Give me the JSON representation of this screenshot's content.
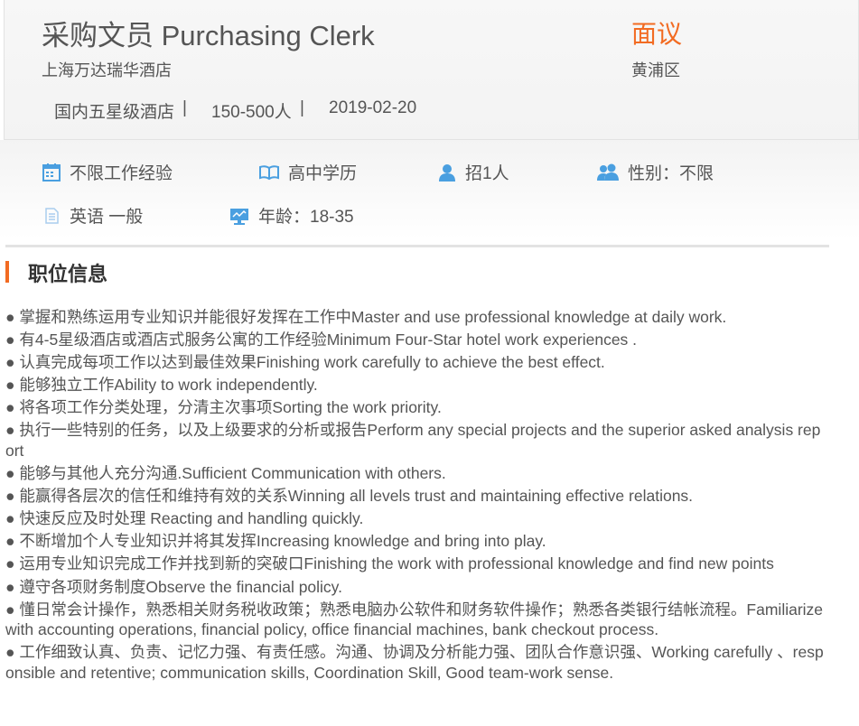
{
  "header": {
    "title": "采购文员 Purchasing Clerk",
    "salary": "面议",
    "company": "上海万达瑞华酒店",
    "district": "黄浦区",
    "meta": {
      "industry": "国内五星级酒店",
      "size": "150-500人",
      "date": "2019-02-20",
      "separator": "|"
    }
  },
  "requirements": {
    "experience": "不限工作经验",
    "education": "高中学历",
    "headcount": "招1人",
    "gender": "性别：不限",
    "language": "英语 一般",
    "age": "年龄：18-35",
    "icons": {
      "experience": "calendar-icon",
      "education": "book-icon",
      "headcount": "person-icon",
      "gender": "people-icon",
      "language": "document-icon",
      "age": "monitor-icon"
    },
    "icon_color": "#4a9fe0"
  },
  "section": {
    "title": "职位信息",
    "accent": "#f26b22"
  },
  "duties": [
    "● 掌握和熟练运用专业知识并能很好发挥在工作中Master and use professional knowledge at daily work.",
    "● 有4-5星级酒店或酒店式服务公寓的工作经验Minimum Four-Star hotel work experiences .",
    "● 认真完成每项工作以达到最佳效果Finishing work carefully  to achieve the best effect.",
    "● 能够独立工作Ability to work independently.",
    "● 将各项工作分类处理，分清主次事项Sorting the work priority.",
    "● 执行一些特别的任务，以及上级要求的分析或报告Perform any special projects and the superior asked analysis report",
    "● 能够与其他人充分沟通.Sufficient Communication with others.",
    "● 能赢得各层次的信任和维持有效的关系Winning all levels trust and maintaining effective relations.",
    "● 快速反应及时处理 Reacting and handling quickly.",
    "● 不断增加个人专业知识并将其发挥Increasing knowledge and bring into play.",
    "● 运用专业知识完成工作并找到新的突破口Finishing the work with professional knowledge and find new points",
    "● 遵守各项财务制度Observe the financial policy.",
    "● 懂日常会计操作，熟悉相关财务税收政策；熟悉电脑办公软件和财务软件操作；熟悉各类银行结帐流程。Familiarize with accounting operations, financial policy, office financial machines, bank checkout process.",
    "● 工作细致认真、负责、记忆力强、有责任感。沟通、协调及分析能力强、团队合作意识强、Working carefully 、responsible and retentive; communication skills, Coordination Skill, Good team-work sense."
  ]
}
